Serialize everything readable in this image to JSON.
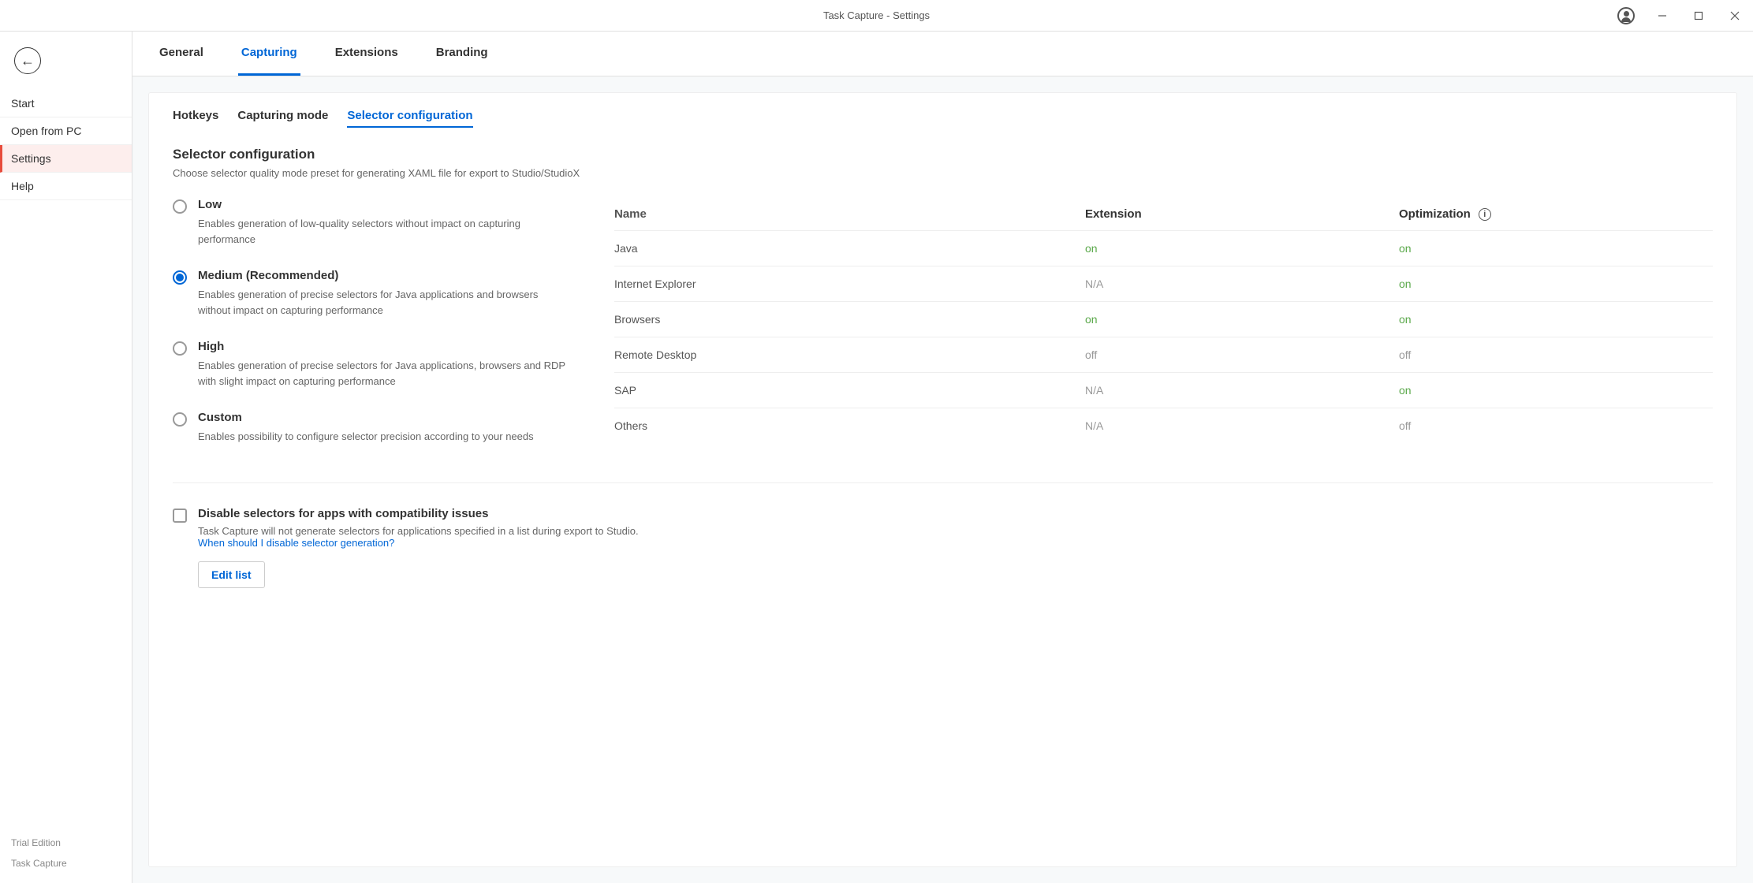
{
  "app": {
    "title": "Task Capture - Settings"
  },
  "sidebar": {
    "items": [
      "Start",
      "Open from PC",
      "Settings",
      "Help"
    ],
    "activeIndex": 2,
    "footer": {
      "edition": "Trial Edition",
      "product": "Task Capture"
    }
  },
  "tabs": {
    "items": [
      "General",
      "Capturing",
      "Extensions",
      "Branding"
    ],
    "activeIndex": 1
  },
  "subtabs": {
    "items": [
      "Hotkeys",
      "Capturing mode",
      "Selector configuration"
    ],
    "activeIndex": 2
  },
  "section": {
    "title": "Selector configuration",
    "description": "Choose selector quality mode preset for generating XAML file for export to Studio/StudioX"
  },
  "radios": {
    "selectedIndex": 1,
    "options": [
      {
        "label": "Low",
        "desc": "Enables generation of low-quality selectors without impact on capturing performance"
      },
      {
        "label": "Medium (Recommended)",
        "desc": "Enables generation of precise selectors for Java applications and browsers without impact on capturing performance"
      },
      {
        "label": "High",
        "desc": "Enables generation of precise selectors for Java applications, browsers and RDP with slight impact on capturing performance"
      },
      {
        "label": "Custom",
        "desc": "Enables possibility to configure selector precision according to your needs"
      }
    ]
  },
  "extTable": {
    "headers": {
      "name": "Name",
      "extension": "Extension",
      "optimization": "Optimization"
    },
    "rows": [
      {
        "name": "Java",
        "extension": "on",
        "optimization": "on"
      },
      {
        "name": "Internet Explorer",
        "extension": "N/A",
        "optimization": "on"
      },
      {
        "name": "Browsers",
        "extension": "on",
        "optimization": "on"
      },
      {
        "name": "Remote Desktop",
        "extension": "off",
        "optimization": "off"
      },
      {
        "name": "SAP",
        "extension": "N/A",
        "optimization": "on"
      },
      {
        "name": "Others",
        "extension": "N/A",
        "optimization": "off"
      }
    ]
  },
  "disableSection": {
    "label": "Disable selectors for apps with compatibility issues",
    "desc": "Task Capture will not generate selectors for applications specified in a list during export to Studio.",
    "link": "When should I disable selector generation?",
    "buttonLabel": "Edit list"
  }
}
